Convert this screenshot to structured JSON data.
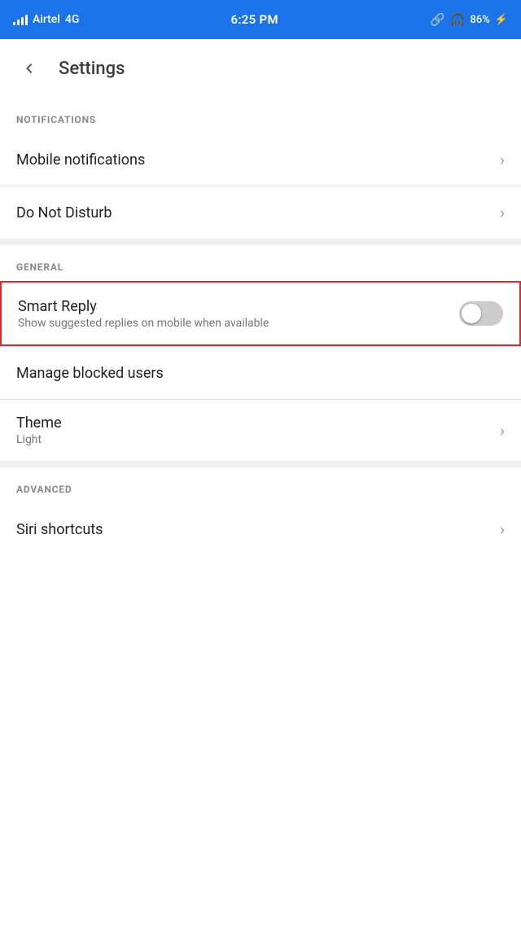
{
  "statusBar": {
    "carrier": "Airtel",
    "network": "4G",
    "time": "6:25 PM",
    "batteryPercent": "86%"
  },
  "appBar": {
    "title": "Settings",
    "backLabel": "Back"
  },
  "sections": {
    "notifications": {
      "label": "NOTIFICATIONS",
      "items": [
        {
          "id": "mobile-notifications",
          "title": "Mobile notifications",
          "subtitle": "",
          "hasChevron": true
        },
        {
          "id": "do-not-disturb",
          "title": "Do Not Disturb",
          "subtitle": "",
          "hasChevron": true
        }
      ]
    },
    "general": {
      "label": "GENERAL",
      "items": [
        {
          "id": "smart-reply",
          "title": "Smart Reply",
          "subtitle": "Show suggested replies on mobile when available",
          "hasToggle": true,
          "toggleOn": false,
          "highlighted": true
        },
        {
          "id": "manage-blocked-users",
          "title": "Manage blocked users",
          "subtitle": "",
          "hasChevron": false
        },
        {
          "id": "theme",
          "title": "Theme",
          "subtitle": "Light",
          "hasChevron": true
        }
      ]
    },
    "advanced": {
      "label": "ADVANCED",
      "items": [
        {
          "id": "siri-shortcuts",
          "title": "Siri shortcuts",
          "subtitle": "",
          "hasChevron": true
        }
      ]
    }
  }
}
